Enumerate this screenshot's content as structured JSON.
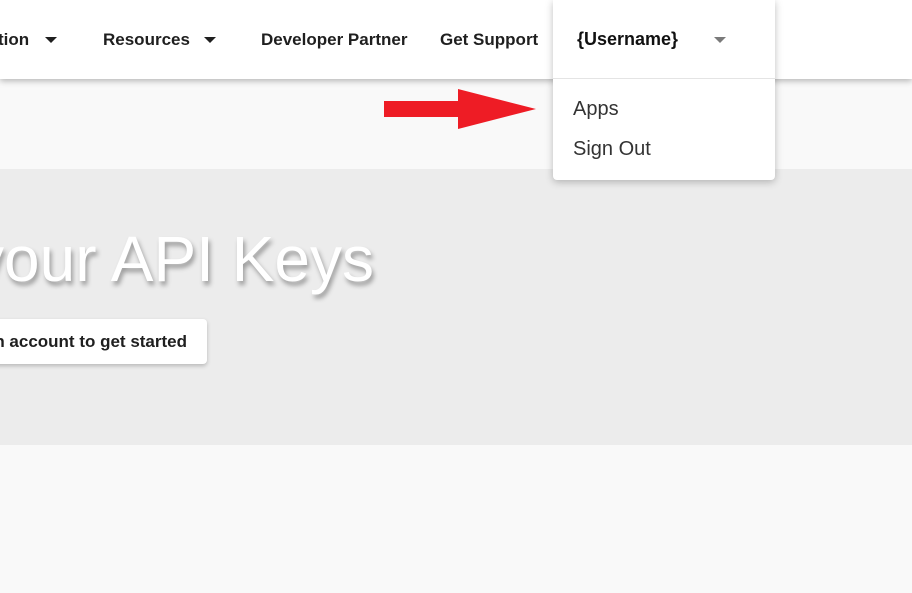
{
  "navbar": {
    "items": [
      {
        "label": "tion",
        "has_dropdown": true
      },
      {
        "label": "Resources",
        "has_dropdown": true
      },
      {
        "label": "Developer Partner",
        "has_dropdown": false
      },
      {
        "label": "Get Support",
        "has_dropdown": false
      }
    ],
    "user_menu": {
      "username": "{Username}",
      "items": [
        {
          "label": "Apps"
        },
        {
          "label": "Sign Out"
        }
      ]
    }
  },
  "hero": {
    "title": "your API Keys",
    "cta_label": "n account to get started"
  },
  "annotation": {
    "arrow_color": "#ee1c25",
    "points_to": "Apps"
  },
  "colors": {
    "navbar_bg": "#ffffff",
    "page_bg": "#f9f9f9",
    "hero_bg": "#ececec",
    "hero_title": "#ffffff"
  }
}
